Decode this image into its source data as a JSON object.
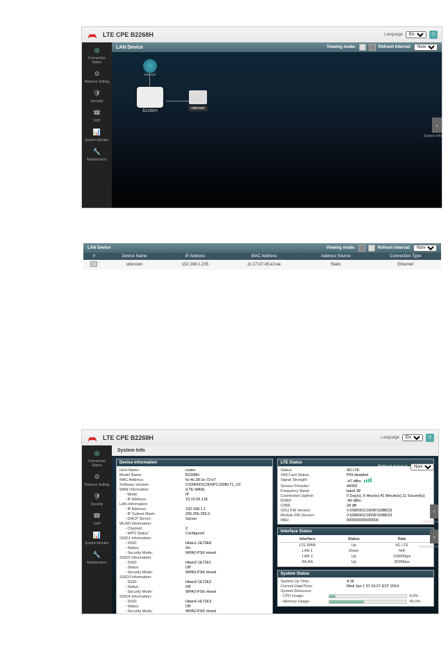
{
  "product": "LTE CPE B2268H",
  "language_label": "Language",
  "language_value": "English",
  "logout_icon": "logout",
  "sidebar": [
    {
      "label": "Connection Status",
      "icon": "◎"
    },
    {
      "label": "Network Setting",
      "icon": "⚙"
    },
    {
      "label": "Security",
      "icon": "🛡"
    },
    {
      "label": "VoIP",
      "icon": "☎"
    },
    {
      "label": "System Monitor",
      "icon": "📊"
    },
    {
      "label": "Maintenance",
      "icon": "🔧"
    }
  ],
  "lan_panel": {
    "title": "LAN Device",
    "viewing_mode": "Viewing mode:",
    "refresh_interval": "Refresh Interval:",
    "refresh_value": "None",
    "router_label": "B2268H",
    "internet_label": "Internet",
    "client_label": "unknown",
    "arrow_label": "System Info"
  },
  "device_table": {
    "title": "LAN Device",
    "viewing_mode": "Viewing mode:",
    "refresh_interval": "Refresh Interval:",
    "refresh_value": "None",
    "columns": [
      "#",
      "Device Name",
      "IP Address",
      "MAC Address",
      "Address Source",
      "Connection Type"
    ],
    "rows": [
      {
        "name": "unknown",
        "ip": "192.168.1.235",
        "mac": "2c:27:d7:45:e2:ee",
        "src": "Static",
        "type": "Ethernet"
      }
    ]
  },
  "system_info": {
    "title": "System Info",
    "refresh_interval": "Refresh Interval:",
    "refresh_value": "None",
    "arrow_left_label": "LAN Device",
    "arrow_right_label": "Virtual Device",
    "device_info": {
      "header": "Device Information",
      "rows": [
        {
          "k": "Host Name:",
          "v": "router"
        },
        {
          "k": "Model Name:",
          "v": "B2268H"
        },
        {
          "k": "MAC Address:",
          "v": "6c:4c:39:1e:72:e7"
        },
        {
          "k": "Software Version:",
          "v": "V100R001C00SPC100B171_V3"
        },
        {
          "k": "WAN Information",
          "v": "(LTE WAN)"
        },
        {
          "k": "- Mode:",
          "v": "IP",
          "sub": true
        },
        {
          "k": "- IP Address:",
          "v": "10.19.56.118",
          "sub": true
        },
        {
          "k": "LAN Information:",
          "v": ""
        },
        {
          "k": "- IP Address:",
          "v": "192.168.1.1",
          "sub": true
        },
        {
          "k": "- IP Subnet Mask:",
          "v": "255.255.255.0",
          "sub": true
        },
        {
          "k": "- DHCP Server:",
          "v": "Server",
          "sub": true
        },
        {
          "k": "WLAN Information:",
          "v": ""
        },
        {
          "k": "- Channel:",
          "v": "3",
          "sub": true
        },
        {
          "k": "- WPS Status:",
          "v": "Configured",
          "sub": true
        },
        {
          "k": "SSID1 Information:",
          "v": ""
        },
        {
          "k": "- SSID:",
          "v": "Hitan1-1E70E8",
          "sub": true
        },
        {
          "k": "- Status:",
          "v": "On",
          "sub": true
        },
        {
          "k": "- Security Mode:",
          "v": "WPA2-PSK mixed",
          "sub": true
        },
        {
          "k": "SSID2 Information:",
          "v": ""
        },
        {
          "k": "- SSID:",
          "v": "Hitan2-1E72E1",
          "sub": true
        },
        {
          "k": "- Status:",
          "v": "Off",
          "sub": true
        },
        {
          "k": "- Security Mode:",
          "v": "WPA2-PSK mixed",
          "sub": true
        },
        {
          "k": "SSID3 Information:",
          "v": ""
        },
        {
          "k": "- SSID:",
          "v": "Hitan3-1E72E2",
          "sub": true
        },
        {
          "k": "- Status:",
          "v": "Off",
          "sub": true
        },
        {
          "k": "- Security Mode:",
          "v": "WPA2-PSK mixed",
          "sub": true
        },
        {
          "k": "SSID4 Information:",
          "v": ""
        },
        {
          "k": "- SSID:",
          "v": "Hitan4-1E72E3",
          "sub": true
        },
        {
          "k": "- Status:",
          "v": "Off",
          "sub": true
        },
        {
          "k": "- Security Mode:",
          "v": "WPA2-PSK mixed",
          "sub": true
        }
      ]
    },
    "lte_status": {
      "header": "LTE Status",
      "rows": [
        {
          "k": "Status:",
          "v": "4G LTE"
        },
        {
          "k": "SIM Card Status:",
          "v": "PIN disabled"
        },
        {
          "k": "Signal Strength:",
          "v": "-47 dBm",
          "signal": true
        },
        {
          "k": "Service Provider:",
          "v": "46000"
        },
        {
          "k": "Frequency Band:",
          "v": "band 38"
        },
        {
          "k": "Connection Uptime:",
          "v": "0 Day(s), 6 Hour(s),41 Minute(s),11 Second(s)"
        },
        {
          "k": "RSRP:",
          "v": "-80 dBm"
        },
        {
          "k": "CINR:",
          "v": "28 dB"
        },
        {
          "k": "ODU FW Version:",
          "v": "V100R001C00SP100B023"
        },
        {
          "k": "Module FW Version:",
          "v": "V100R001C00SP100B023"
        },
        {
          "k": "IMEI:",
          "v": "000000000000000"
        }
      ]
    },
    "interface_status": {
      "header": "Interface Status",
      "columns": [
        "Interface",
        "Status",
        "Rate"
      ],
      "rows": [
        {
          "i": "LTE WAN",
          "s": "Up",
          "r": "4G LTE"
        },
        {
          "i": "LAN 1",
          "s": "Down",
          "r": "N/A"
        },
        {
          "i": "LAN 2",
          "s": "Up",
          "r": "1000Mbps"
        },
        {
          "i": "WLAN",
          "s": "Up",
          "r": "300Mbps"
        }
      ]
    },
    "system_status": {
      "header": "System Status",
      "uptime_k": "System Up Time:",
      "uptime_v": "4:16",
      "datetime_k": "Current Date/Time:",
      "datetime_v": "Wed Jan 1 07:16:27 EST 2014",
      "resource_label": "System Resource:",
      "cpu_k": "- CPU Usage:",
      "cpu_v": "8.0%",
      "cpu_pct": 8,
      "mem_k": "- Memory Usage:",
      "mem_v": "45.0%",
      "mem_pct": 45
    }
  }
}
